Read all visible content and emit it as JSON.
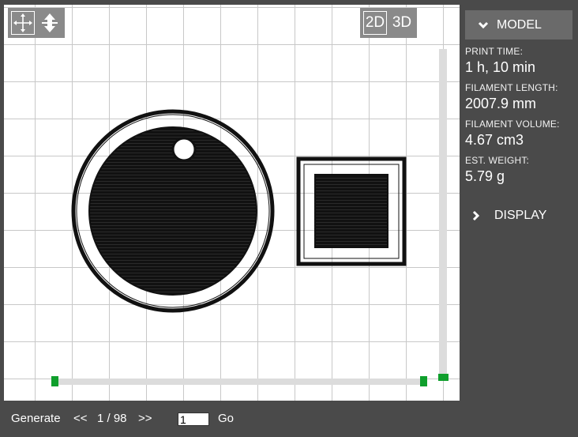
{
  "viewport": {
    "view_modes": {
      "mode_2d": "2D",
      "mode_3d": "3D",
      "active": "2D"
    },
    "tools": {
      "pan": "move-arrows-icon",
      "lift": "lift-arrows-icon"
    }
  },
  "sidebar": {
    "model_section": {
      "title": "MODEL",
      "stats": {
        "print_time_label": "PRINT TIME:",
        "print_time_value": "1 h, 10 min",
        "filament_length_label": "FILAMENT LENGTH:",
        "filament_length_value": "2007.9 mm",
        "filament_volume_label": "FILAMENT VOLUME:",
        "filament_volume_value": "4.67 cm3",
        "est_weight_label": "EST. WEIGHT:",
        "est_weight_value": "5.79 g"
      }
    },
    "display_section": {
      "title": "DISPLAY"
    }
  },
  "bottombar": {
    "generate_label": "Generate",
    "prev_label": "<<",
    "layer_counter": "1 / 98",
    "next_label": ">>",
    "layer_input_value": "1",
    "go_label": "Go"
  },
  "colors": {
    "handle": "#0f9f2c",
    "panel": "#4a4a4a",
    "header": "#6a6a6a"
  }
}
